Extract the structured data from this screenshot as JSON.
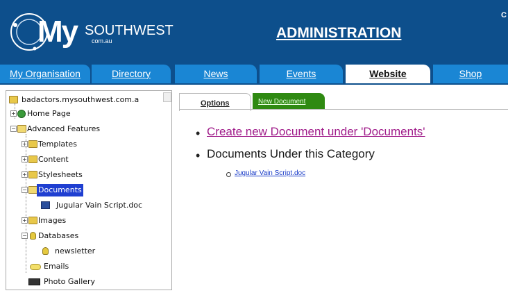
{
  "header": {
    "logo": {
      "my": "My",
      "southwest": "SOUTHWEST",
      "domain": "com.au"
    },
    "title": "ADMINISTRATION",
    "corner_text": "C",
    "background_color": "#0d4f8c"
  },
  "nav": {
    "tabs": [
      {
        "label": "My Organisation",
        "active": false
      },
      {
        "label": "Directory",
        "active": false
      },
      {
        "label": "News",
        "active": false
      },
      {
        "label": "Events",
        "active": false
      },
      {
        "label": "Website",
        "active": true
      },
      {
        "label": "Shop",
        "active": false
      }
    ],
    "tab_color": "#1a86d4"
  },
  "tree": {
    "root": "badactors.mysouthwest.com.a",
    "items": [
      {
        "label": "Home Page",
        "icon": "globe-icon"
      },
      {
        "label": "Advanced Features",
        "icon": "folder-open-icon"
      },
      {
        "label": "Templates",
        "icon": "folder-icon"
      },
      {
        "label": "Content",
        "icon": "folder-icon"
      },
      {
        "label": "Stylesheets",
        "icon": "folder-icon"
      },
      {
        "label": "Documents",
        "icon": "folder-open-icon",
        "selected": true
      },
      {
        "label": "Jugular Vain Script.doc",
        "icon": "document-icon"
      },
      {
        "label": "Images",
        "icon": "folder-icon"
      },
      {
        "label": "Databases",
        "icon": "database-icon"
      },
      {
        "label": "newsletter",
        "icon": "database-icon"
      },
      {
        "label": "Emails",
        "icon": "email-icon"
      },
      {
        "label": "Photo Gallery",
        "icon": "camera-icon"
      }
    ]
  },
  "content_tabs": {
    "options": "Options",
    "new_document": "New Document"
  },
  "content": {
    "create_link": "Create new Document under 'Documents'",
    "heading": "Documents Under this Category",
    "documents": [
      "Jugular Vain Script.doc"
    ]
  }
}
